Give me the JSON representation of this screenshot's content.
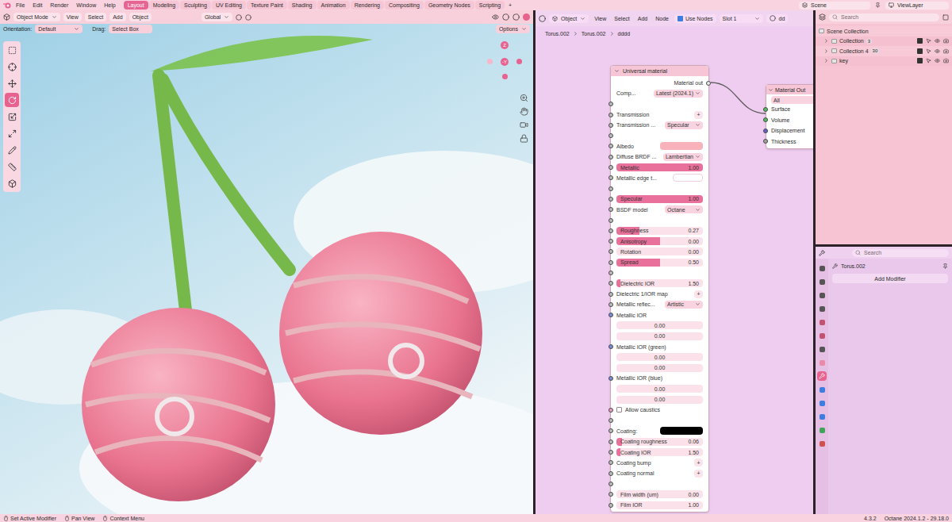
{
  "top_bar": {
    "menus": [
      "File",
      "Edit",
      "Render",
      "Window",
      "Help"
    ],
    "workspaces": [
      {
        "label": "Layout",
        "selected": true
      },
      {
        "label": "Modeling",
        "selected": false
      },
      {
        "label": "Sculpting",
        "selected": false
      },
      {
        "label": "UV Editing",
        "selected": false
      },
      {
        "label": "Texture Paint",
        "selected": false
      },
      {
        "label": "Shading",
        "selected": false
      },
      {
        "label": "Animation",
        "selected": false
      },
      {
        "label": "Rendering",
        "selected": false
      },
      {
        "label": "Compositing",
        "selected": false
      },
      {
        "label": "Geometry Nodes",
        "selected": false
      },
      {
        "label": "Scripting",
        "selected": false
      }
    ],
    "add_workspace": "+",
    "scene": "Scene",
    "view_layer": "ViewLayer"
  },
  "viewport": {
    "mode": "Object Mode",
    "menus": [
      "View",
      "Select",
      "Add",
      "Object"
    ],
    "transform": "Global",
    "orientation_label": "Orientation:",
    "orientation": "Default",
    "drag_label": "Drag:",
    "drag": "Select Box",
    "options": "Options",
    "gizmo_axes": [
      {
        "label": "Z",
        "color": "#e8628f"
      },
      {
        "label": "-Y",
        "color": "#e8628f"
      }
    ],
    "tools": [
      {
        "selected": false
      },
      {
        "selected": false
      },
      {
        "selected": false
      },
      {
        "selected": true
      },
      {
        "selected": false
      },
      {
        "selected": false
      },
      {
        "selected": false
      },
      {
        "selected": false
      },
      {
        "selected": false
      }
    ]
  },
  "node_editor": {
    "editor_type": "Object",
    "menus": [
      "View",
      "Select",
      "Add",
      "Node"
    ],
    "use_nodes": {
      "label": "Use Nodes",
      "checked": true
    },
    "slot": "Slot 1",
    "material": "dd",
    "breadcrumbs": [
      "Torus.002",
      "Torus.002",
      "dddd"
    ],
    "universal_node": {
      "title": "Universal material",
      "rows": [
        {
          "kind": "output",
          "label": "Material out"
        },
        {
          "kind": "dropdown",
          "label": "Comp...",
          "value": "Latest (2024.1)"
        },
        {
          "kind": "empty",
          "socket": "#bdbdbd"
        },
        {
          "kind": "plus",
          "label": "Transmission",
          "value": "+",
          "socket": "#bdbdbd"
        },
        {
          "kind": "dropdown",
          "label": "Transmission ...",
          "value": "Specular",
          "socket": "#bdbdbd"
        },
        {
          "kind": "empty",
          "socket": "#bdbdbd"
        },
        {
          "kind": "color",
          "label": "Albedo",
          "color": "#f7b3b9",
          "socket": "#bdbdbd"
        },
        {
          "kind": "dropdown",
          "label": "Diffuse BRDF ...",
          "value": "Lambertian",
          "socket": "#bdbdbd"
        },
        {
          "kind": "slider",
          "label": "Metallic",
          "value": "1.00",
          "level": 1,
          "socket": "#bdbdbd"
        },
        {
          "kind": "field",
          "label": "Metallic edge t...",
          "socket": "#bdbdbd"
        },
        {
          "kind": "empty",
          "socket": "#bdbdbd"
        },
        {
          "kind": "slider",
          "label": "Specular",
          "value": "1.00",
          "level": 1,
          "socket": "#bdbdbd"
        },
        {
          "kind": "dropdown",
          "label": "BSDF model",
          "value": "Octane",
          "socket": "#bdbdbd"
        },
        {
          "kind": "empty",
          "socket": "#bdbdbd"
        },
        {
          "kind": "slider",
          "label": "Roughness",
          "value": "0.27",
          "level": 0.27,
          "socket": "#bdbdbd"
        },
        {
          "kind": "slider",
          "label": "Anisotropy",
          "value": "0.00",
          "level": 0.5,
          "socket": "#bdbdbd"
        },
        {
          "kind": "slider",
          "label": "Rotation",
          "value": "0.00",
          "level": 0,
          "socket": "#bdbdbd"
        },
        {
          "kind": "slider",
          "label": "Spread",
          "value": "0.50",
          "level": 0.5,
          "socket": "#bdbdbd"
        },
        {
          "kind": "empty",
          "socket": "#bdbdbd"
        },
        {
          "kind": "slider",
          "label": "Dielectric IOR",
          "value": "1.50",
          "level": 0.05,
          "socket": "#bdbdbd"
        },
        {
          "kind": "plus",
          "label": "Dielectric 1/IOR map",
          "value": "+",
          "socket": "#bdbdbd"
        },
        {
          "kind": "dropdown",
          "label": "Metallic reflec...",
          "value": "Artistic",
          "socket": "#bdbdbd"
        },
        {
          "kind": "label",
          "label": "Metallic IOR",
          "socket": "#7b8fd6"
        },
        {
          "kind": "number",
          "value": "0.00"
        },
        {
          "kind": "number",
          "value": "0.00"
        },
        {
          "kind": "label",
          "label": "Metallic IOR (green)",
          "socket": "#7b8fd6"
        },
        {
          "kind": "number",
          "value": "0.00"
        },
        {
          "kind": "number",
          "value": "0.00"
        },
        {
          "kind": "label",
          "label": "Metallic IOR (blue)",
          "socket": "#7b8fd6"
        },
        {
          "kind": "number",
          "value": "0.00"
        },
        {
          "kind": "number",
          "value": "0.00"
        },
        {
          "kind": "checkbox",
          "label": "Allow caustics",
          "checked": false,
          "socket": "#e8a0bb"
        },
        {
          "kind": "empty",
          "socket": "#bdbdbd"
        },
        {
          "kind": "color",
          "label": "Coating:",
          "color": "#000000",
          "socket": "#bdbdbd"
        },
        {
          "kind": "slider",
          "label": "Coating roughness",
          "value": "0.06",
          "level": 0.06,
          "socket": "#bdbdbd"
        },
        {
          "kind": "slider",
          "label": "Coating IOR",
          "value": "1.50",
          "level": 0.05,
          "socket": "#bdbdbd"
        },
        {
          "kind": "plus",
          "label": "Coating bump",
          "value": "+",
          "socket": "#bdbdbd"
        },
        {
          "kind": "plus",
          "label": "Coating normal",
          "value": "+",
          "socket": "#bdbdbd"
        },
        {
          "kind": "empty",
          "socket": "#bdbdbd"
        },
        {
          "kind": "slider",
          "label": "Film width (um)",
          "value": "0.00",
          "level": 0,
          "socket": "#bdbdbd"
        },
        {
          "kind": "slider",
          "label": "Film IOR",
          "value": "1.00",
          "level": 0,
          "socket": "#bdbdbd"
        }
      ]
    },
    "output_node": {
      "title": "Material Out",
      "target": "All",
      "inputs": [
        {
          "label": "Surface",
          "color": "#4fbf5a"
        },
        {
          "label": "Volume",
          "color": "#4fbf5a"
        },
        {
          "label": "Displacement",
          "color": "#6363c7"
        },
        {
          "label": "Thickness",
          "color": "#a1a1a1"
        }
      ]
    }
  },
  "outliner": {
    "search": "Search",
    "items": [
      {
        "label": "Scene Collection",
        "depth": 0,
        "expander": false,
        "badge": "",
        "visible": true
      },
      {
        "label": "Collection",
        "depth": 1,
        "expander": true,
        "badge": "3",
        "visible": true
      },
      {
        "label": "Collection 4",
        "depth": 1,
        "expander": true,
        "badge": "30",
        "visible": true
      },
      {
        "label": "key",
        "depth": 1,
        "expander": true,
        "badge": "",
        "visible": true
      }
    ]
  },
  "properties": {
    "search": "Search",
    "object": "Torus.002",
    "add_modifier": "Add Modifier",
    "tabs": [
      {
        "color": "#555555",
        "selected": false
      },
      {
        "color": "#555555",
        "selected": false
      },
      {
        "color": "#555555",
        "selected": false
      },
      {
        "color": "#555555",
        "selected": false
      },
      {
        "color": "#c2526f",
        "selected": false
      },
      {
        "color": "#c2526f",
        "selected": false
      },
      {
        "color": "#555555",
        "selected": false
      },
      {
        "color": "#e88aa8",
        "selected": false
      },
      {
        "color": "#3d7de0",
        "selected": true
      },
      {
        "color": "#3d7de0",
        "selected": false
      },
      {
        "color": "#3d7de0",
        "selected": false
      },
      {
        "color": "#3d7de0",
        "selected": false
      },
      {
        "color": "#3fa45a",
        "selected": false
      },
      {
        "color": "#d14f4f",
        "selected": false
      }
    ]
  },
  "status_bar": {
    "hints": [
      "Set Active Modifier",
      "Pan View",
      "Context Menu"
    ],
    "version": "4.3.2",
    "renderer": "Octane 2024.1.2 - 29.18.0"
  }
}
